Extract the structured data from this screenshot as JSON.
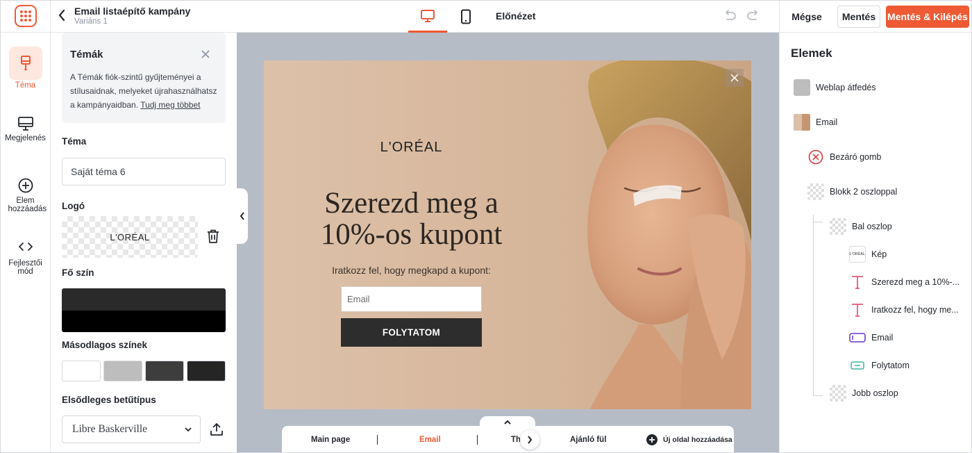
{
  "header": {
    "campaign_title": "Email listaépítő kampány",
    "variant": "Variáns 1",
    "preview": "Előnézet",
    "cancel": "Mégse",
    "save": "Mentés",
    "save_exit": "Mentés & Kilépés",
    "accent": "#ee5a34"
  },
  "rail": {
    "items": [
      {
        "label": "Téma",
        "icon": "brush-icon"
      },
      {
        "label": "Megjelenés",
        "icon": "monitor-icon"
      },
      {
        "label": "Elem hozzáadás",
        "icon": "plus-circle-icon"
      },
      {
        "label": "Fejlesztői mód",
        "icon": "code-icon"
      }
    ]
  },
  "left_panel": {
    "info_title": "Témák",
    "info_text": "A Témák fiók-szintű gyűjteményei a stílusaidnak, melyeket újrahasználhatsz a kampányaidban.",
    "info_link": "Tudj meg többet",
    "theme_label": "Téma",
    "theme_value": "Saját téma 6",
    "logo_label": "Logó",
    "logo_text": "L'ORÉAL",
    "main_color_label": "Fő szín",
    "secondary_label": "Másodlagos színek",
    "secondary_colors": [
      "#ffffff",
      "#bdbdbd",
      "#3d3d3d",
      "#252525"
    ],
    "font_label": "Elsődleges betűtípus",
    "font_value": "Libre Baskerville"
  },
  "popup": {
    "brand": "L'ORÉAL",
    "headline_1": "Szerezd meg a",
    "headline_2": "10%-os kupont",
    "subline": "Iratkozz fel, hogy megkapd a kupont:",
    "email_placeholder": "Email",
    "cta": "FOLYTATOM"
  },
  "page_tabs": {
    "tabs": [
      "Main page",
      "Email",
      "Th",
      "Ajánló fül"
    ],
    "active": "Email",
    "add_page": "Új oldal hozzáadása"
  },
  "elements_panel": {
    "title": "Elemek",
    "items": [
      {
        "label": "Weblap átfedés",
        "icon": "overlay-icon"
      },
      {
        "label": "Email",
        "icon": "email-thumb-icon"
      },
      {
        "label": "Bezáró gomb",
        "icon": "close-circle-icon"
      },
      {
        "label": "Blokk 2 oszloppal",
        "icon": "block-icon"
      },
      {
        "label": "Bal oszlop",
        "icon": "column-icon"
      },
      {
        "label": "Kép",
        "icon": "image-icon"
      },
      {
        "label": "Szerezd meg a 10%-...",
        "icon": "text-icon"
      },
      {
        "label": "Iratkozz fel, hogy me...",
        "icon": "text-icon"
      },
      {
        "label": "Email",
        "icon": "input-icon"
      },
      {
        "label": "Folytatom",
        "icon": "button-icon"
      },
      {
        "label": "Jobb oszlop",
        "icon": "column-icon"
      }
    ]
  }
}
